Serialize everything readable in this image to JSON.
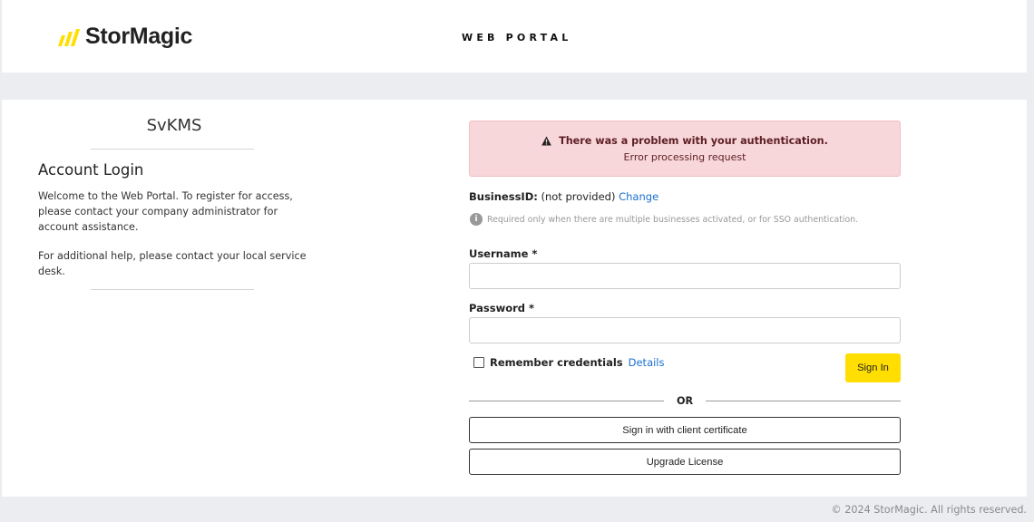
{
  "header": {
    "logo_text": "StorMagic",
    "portal_title": "WEB PORTAL",
    "brand_color": "#ffde00"
  },
  "left_panel": {
    "product_name": "SvKMS",
    "login_heading": "Account Login",
    "welcome_text": "Welcome to the Web Portal. To register for access, please contact your company administrator for account assistance.",
    "help_text": "For additional help, please contact your local service desk."
  },
  "alert": {
    "icon": "warning-icon",
    "title": "There was a problem with your authentication.",
    "message": "Error processing request",
    "bg_color": "#f8d7da"
  },
  "business_id": {
    "label": "BusinessID:",
    "value": "(not provided)",
    "change_link": "Change",
    "hint_icon": "info-icon",
    "hint": "Required only when there are multiple businesses activated, or for SSO authentication."
  },
  "form": {
    "username_label": "Username *",
    "username_value": "",
    "password_label": "Password *",
    "password_value": "",
    "remember_label": "Remember credentials",
    "remember_checked": false,
    "details_link": "Details",
    "sign_in_label": "Sign In",
    "or_label": "OR",
    "client_cert_label": "Sign in with client certificate",
    "upgrade_label": "Upgrade License"
  },
  "footer": {
    "copyright": "© 2024 StorMagic. All rights reserved."
  }
}
